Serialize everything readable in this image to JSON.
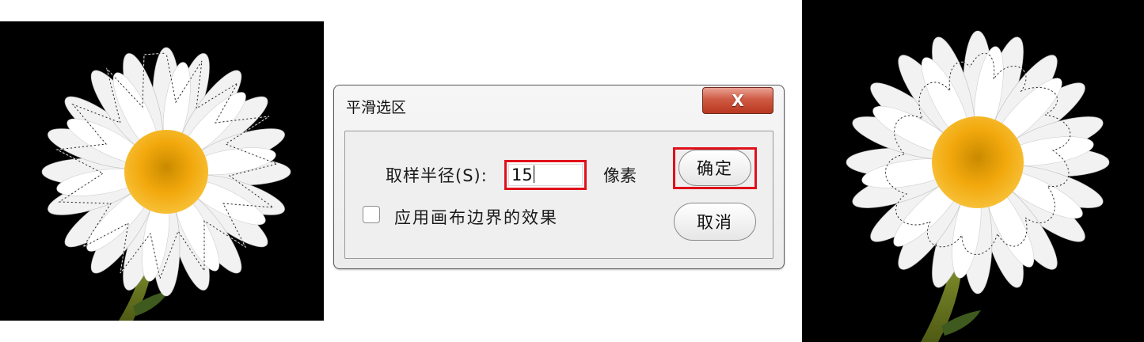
{
  "dialog": {
    "title": "平滑选区",
    "close_glyph": "X",
    "radius_label": "取样半径(S):",
    "radius_value": "15",
    "radius_unit": "像素",
    "checkbox_label": "应用画布边界的效果",
    "checkbox_checked": false,
    "ok_label": "确定",
    "cancel_label": "取消"
  },
  "colors": {
    "highlight": "#e0101a",
    "close_button": "#c84a33",
    "flower_center": "#f2a80c",
    "petal": "#f4f4f4",
    "background_photo": "#000000"
  }
}
